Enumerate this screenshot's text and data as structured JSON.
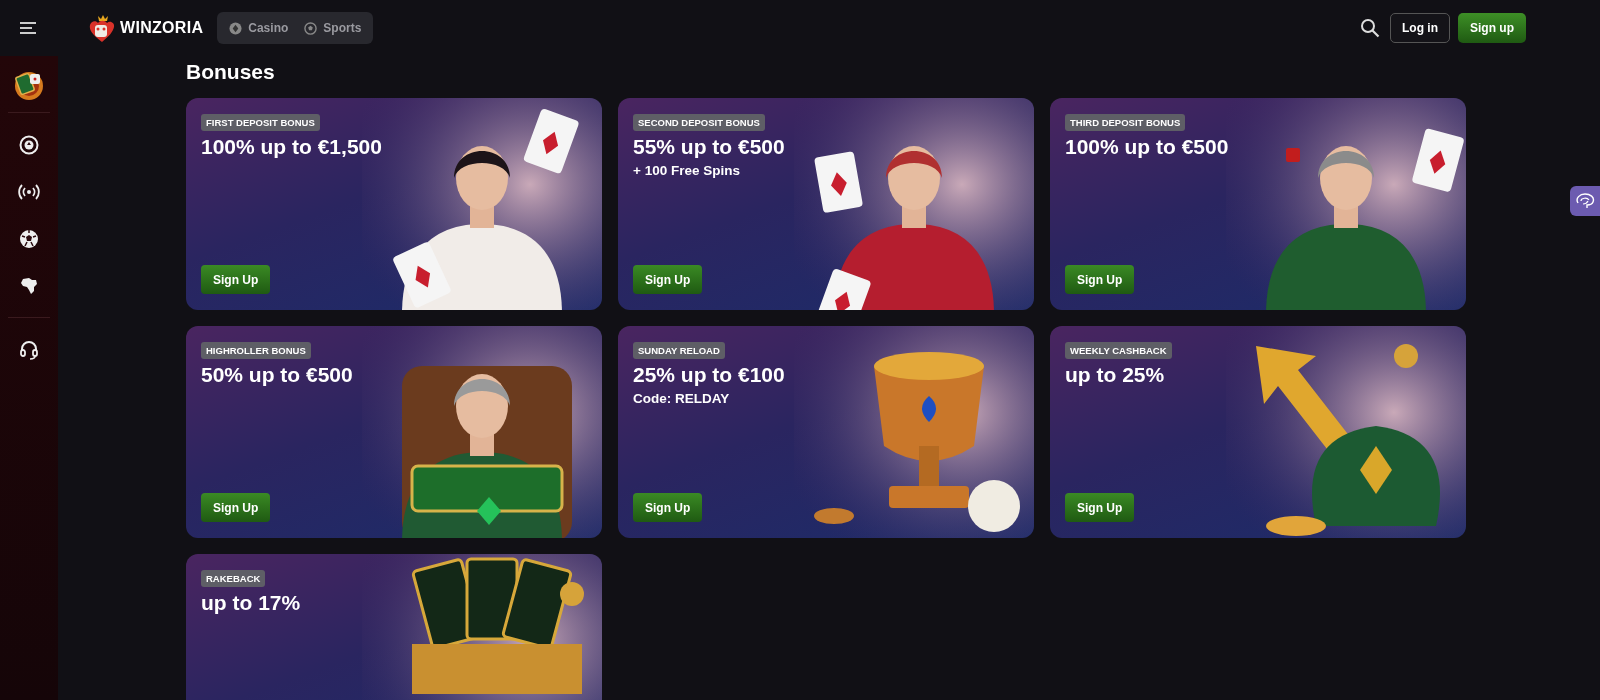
{
  "header": {
    "brand": "WINZORIA",
    "nav": [
      {
        "label": "Casino",
        "kind": "casino",
        "selected": false
      },
      {
        "label": "Sports",
        "kind": "sports",
        "selected": false
      }
    ],
    "login": "Log in",
    "signup": "Sign up"
  },
  "sidebar": {
    "items": [
      {
        "kind": "chip"
      },
      {
        "kind": "live"
      },
      {
        "kind": "ball"
      },
      {
        "kind": "map"
      },
      {
        "kind": "support"
      }
    ]
  },
  "page_title": "Bonuses",
  "bonuses": [
    {
      "tag": "FIRST DEPOSIT BONUS",
      "title": "100% up to €1,500",
      "button": "Sign Up"
    },
    {
      "tag": "SECOND DEPOSIT BONUS",
      "title": "55% up to €500",
      "subtitle": "+ 100 Free Spins",
      "button": "Sign Up"
    },
    {
      "tag": "THIRD DEPOSIT BONUS",
      "title": "100% up to €500",
      "button": "Sign Up"
    },
    {
      "tag": "HIGHROLLER BONUS",
      "title": "50% up to €500",
      "button": "Sign Up"
    },
    {
      "tag": "SUNDAY RELOAD",
      "title": "25% up to €100",
      "subtitle": "Code: RELDAY",
      "button": "Sign Up"
    },
    {
      "tag": "WEEKLY CASHBACK",
      "title": "up to 25%",
      "button": "Sign Up"
    },
    {
      "tag": "RAKEBACK",
      "title": "up to 17%"
    }
  ]
}
